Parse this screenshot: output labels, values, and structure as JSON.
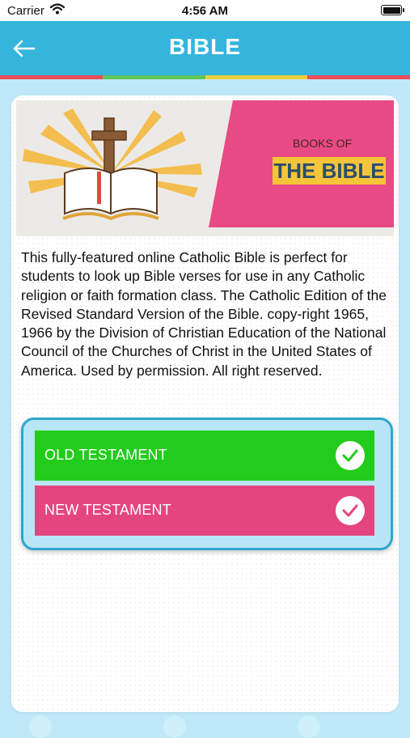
{
  "status_bar": {
    "carrier": "Carrier",
    "time": "4:56 AM"
  },
  "nav": {
    "title": "BIBLE",
    "back_icon": "back-arrow-icon"
  },
  "rainbow_colors": [
    "#e94f5b",
    "#5dc55a",
    "#f1cf3b",
    "#e94f5b"
  ],
  "banner": {
    "line1": "BOOKS OF",
    "line2": "THE BIBLE"
  },
  "description": "This fully-featured online Catholic Bible is perfect for students to look up Bible verses for use in any Catholic religion or faith formation class. The Catholic Edition of the Revised Standard Version of the Bible. copy-right 1965, 1966 by the Division of Christian Education of the National Council of the Churches of Christ in the United States of America. Used by permission. All right reserved.",
  "testaments": {
    "old": {
      "label": "OLD TESTAMENT",
      "color": "#22cc1c",
      "icon": "check-circle-icon"
    },
    "new": {
      "label": "NEW TESTAMENT",
      "color": "#e5457f",
      "icon": "check-circle-icon"
    }
  }
}
